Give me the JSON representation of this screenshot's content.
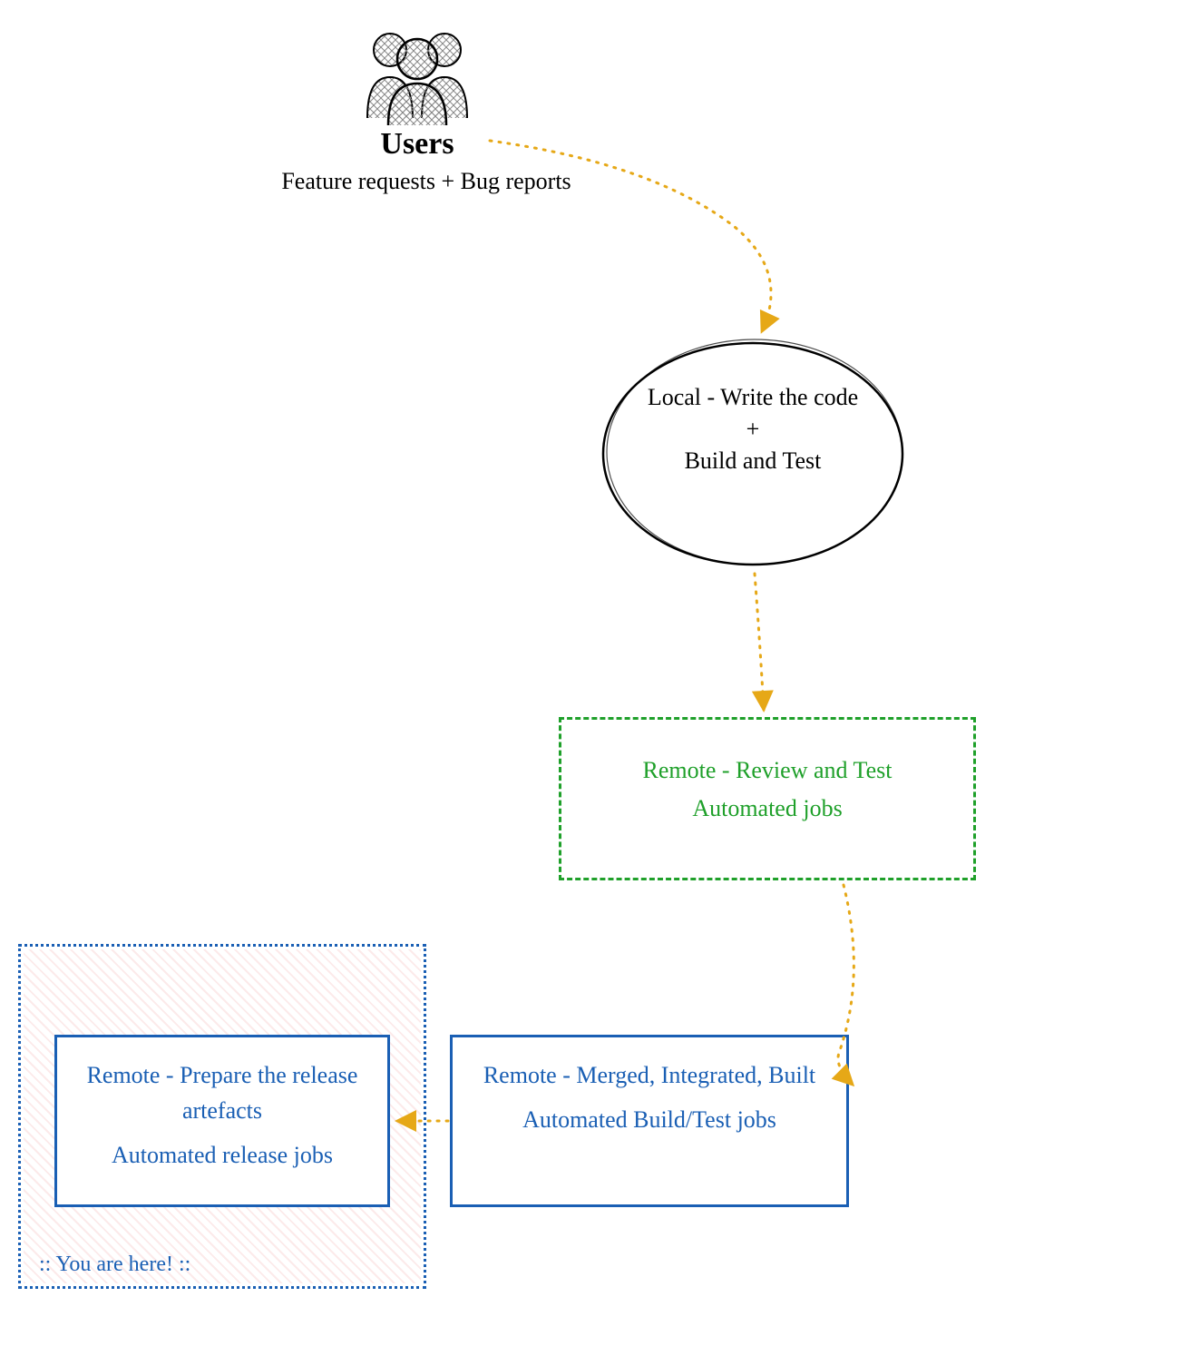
{
  "diagram": {
    "users": {
      "title": "Users",
      "subtitle": "Feature requests + Bug reports"
    },
    "local": {
      "line1": "Local - Write the code",
      "line2": "+",
      "line3": "Build and Test"
    },
    "remote_review": {
      "line1": "Remote - Review and Test",
      "line2": "Automated jobs"
    },
    "remote_merged": {
      "line1": "Remote - Merged, Integrated, Built",
      "line2": "Automated Build/Test jobs"
    },
    "remote_prepare": {
      "line1": "Remote - Prepare the release artefacts",
      "line2": "Automated release jobs"
    },
    "you_are_here": ":: You are here! ::",
    "arrows": [
      {
        "from": "users",
        "to": "local"
      },
      {
        "from": "local",
        "to": "remote_review"
      },
      {
        "from": "remote_review",
        "to": "remote_merged"
      },
      {
        "from": "remote_merged",
        "to": "remote_prepare"
      }
    ],
    "colors": {
      "arrow": "#e6a817",
      "green": "#1fa02a",
      "blue": "#1a5fb4",
      "hatch": "#e65050"
    }
  }
}
